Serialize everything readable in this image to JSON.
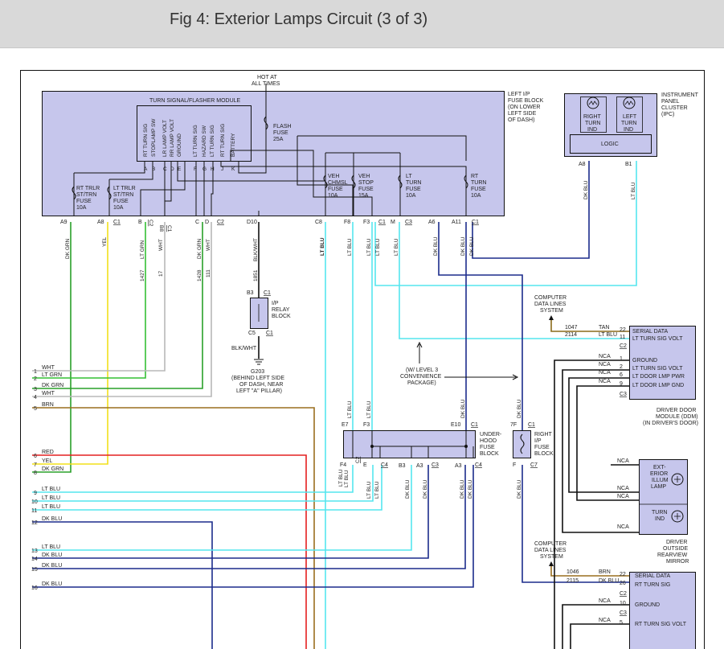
{
  "page": {
    "title": "Fig 4: Exterior Lamps Circuit (3 of 3)"
  },
  "colors": {
    "lt_blu": "#55e6ee",
    "dk_blu": "#1c2c8c",
    "dk_grn": "#2aa02a",
    "lt_grn": "#34c034",
    "yel": "#f2e01a",
    "wht": "#b8b8b8",
    "red": "#e42020",
    "brn": "#9a6e1e",
    "tan": "#8a6a1a",
    "module_fill": "#c6c6ec",
    "black": "#111111"
  },
  "hot": {
    "line1": "HOT AT",
    "line2": "ALL TIMES"
  },
  "ip_fuse_block": {
    "l1": "LEFT I/P",
    "l2": "FUSE BLOCK",
    "l3": "(ON LOWER",
    "l4": "LEFT SIDE",
    "l5": "OF DASH)"
  },
  "flasher": {
    "title": "TURN SIGNAL/FLASHER MODULE",
    "pins": [
      {
        "name": "RT TURN SIG",
        "letter": "A"
      },
      {
        "name": "STOPLAMP SW",
        "letter": "B"
      },
      {
        "name": "LR LAMP VOLT",
        "letter": "C"
      },
      {
        "name": "RR LAMP VOLT",
        "letter": "D"
      },
      {
        "name": "GROUND",
        "letter": "E"
      },
      {
        "name": "LT TURN SIG",
        "letter": "F"
      },
      {
        "name": "HAZARD SW",
        "letter": "G"
      },
      {
        "name": "LT TURN SIG",
        "letter": "H"
      },
      {
        "name": "RT TURN SIG",
        "letter": "J"
      },
      {
        "name": "BATTERY",
        "letter": "K"
      }
    ]
  },
  "fuses": {
    "flash": {
      "l1": "FLASH",
      "l2": "FUSE",
      "l3": "25A"
    },
    "rt_trlr": {
      "l1": "RT TRLR",
      "l2": "ST/TRN",
      "l3": "FUSE",
      "l4": "10A"
    },
    "lt_trlr": {
      "l1": "LT TRLR",
      "l2": "ST/TRN",
      "l3": "FUSE",
      "l4": "10A"
    },
    "veh_chmsl": {
      "l1": "VEH",
      "l2": "CHMSL",
      "l3": "FUSE",
      "l4": "10A"
    },
    "veh_stop": {
      "l1": "VEH",
      "l2": "STOP",
      "l3": "FUSE",
      "l4": "15A"
    },
    "lt_turn": {
      "l1": "LT",
      "l2": "TURN",
      "l3": "FUSE",
      "l4": "10A"
    },
    "rt_turn": {
      "l1": "RT",
      "l2": "TURN",
      "l3": "FUSE",
      "l4": "10A"
    }
  },
  "ipc": {
    "l1": "INSTRUMENT",
    "l2": "PANEL",
    "l3": "CLUSTER",
    "l4": "(IPC)",
    "right_turn": [
      "RIGHT",
      "TURN",
      "IND"
    ],
    "left_turn": [
      "LEFT",
      "TURN",
      "IND"
    ],
    "logic": "LOGIC",
    "pin_a8": "A8",
    "pin_b1": "B1",
    "wire_a8": "DK BLU",
    "wire_b1": "LT BLU"
  },
  "ip_connectors": {
    "a9": "A9",
    "a8": "A8",
    "c1a": "C1",
    "b": "B",
    "b8": "B8",
    "c1b": "C1",
    "c": "C",
    "d": "D",
    "c2": "C2",
    "d10": "D10",
    "c8": "C8",
    "f8": "F8",
    "f3": "F3",
    "c1c": "C1",
    "m": "M",
    "c3": "C3",
    "a6": "A6",
    "a11": "A11",
    "c1d": "C1"
  },
  "ip_wires": {
    "w1": "DK GRN",
    "w2": "YEL",
    "w3": "LT GRN",
    "n3": "1427",
    "w4": "WHT",
    "n4": "17",
    "w5": "DK GRN",
    "n5": "1428",
    "w6": "WHT",
    "n6": "111",
    "w7": "BLK/WHT",
    "n7": "1851",
    "w8": "LT BLU",
    "w9": "LT BLU",
    "w10": "LT BLU",
    "w11": "LT BLU",
    "w12": "DK BLU",
    "w13": "DK BLU",
    "w14": "LT BLU"
  },
  "relay_block": {
    "b3": "B3",
    "c1": "C1",
    "l1": "I/P",
    "l2": "RELAY",
    "l3": "BLOCK",
    "c5": "C5",
    "c1b": "C1",
    "wire": "BLK/WHT",
    "ground": "G203",
    "g1": "(BEHIND LEFT SIDE",
    "g2": "OF DASH, NEAR",
    "g3": "LEFT \"A\" PILLAR)"
  },
  "left_wires": [
    {
      "num": "1",
      "label": "WHT"
    },
    {
      "num": "2",
      "label": "LT GRN"
    },
    {
      "num": "3",
      "label": "DK GRN"
    },
    {
      "num": "4",
      "label": "WHT"
    },
    {
      "num": "5",
      "label": "BRN"
    },
    {
      "num": "6",
      "label": "RED"
    },
    {
      "num": "7",
      "label": "YEL"
    },
    {
      "num": "8",
      "label": "DK GRN"
    },
    {
      "num": "9",
      "label": "LT BLU"
    },
    {
      "num": "10",
      "label": "LT BLU"
    },
    {
      "num": "11",
      "label": "LT BLU"
    },
    {
      "num": "12",
      "label": "DK BLU"
    },
    {
      "num": "13",
      "label": "LT BLU"
    },
    {
      "num": "14",
      "label": "DK BLU"
    },
    {
      "num": "15",
      "label": "DK BLU"
    },
    {
      "num": "16",
      "label": "DK BLU"
    }
  ],
  "cdl1": {
    "l1": "COMPUTER",
    "l2": "DATA LINES",
    "l3": "SYSTEM"
  },
  "ddm": {
    "rows": [
      {
        "circuit": "1047",
        "wire": "TAN",
        "pin": "22",
        "fn": "SERIAL DATA"
      },
      {
        "circuit": "2114",
        "wire": "LT BLU",
        "pin": "11",
        "fn": "LT TURN SIG VOLT"
      },
      {
        "circuit": "",
        "wire": "",
        "pin": "C2",
        "fn": ""
      },
      {
        "circuit": "",
        "wire": "NCA",
        "pin": "1",
        "fn": "GROUND"
      },
      {
        "circuit": "",
        "wire": "NCA",
        "pin": "2",
        "fn": "LT TURN SIG VOLT"
      },
      {
        "circuit": "",
        "wire": "NCA",
        "pin": "6",
        "fn": "LT DOOR LMP PWR"
      },
      {
        "circuit": "",
        "wire": "NCA",
        "pin": "9",
        "fn": "LT DOOR LMP GND"
      },
      {
        "circuit": "",
        "wire": "",
        "pin": "C3",
        "fn": ""
      }
    ],
    "l1": "DRIVER DOOR",
    "l2": "MODULE (DDM)",
    "l3": "(IN DRIVER'S DOOR)"
  },
  "note": {
    "l1": "(W/ LEVEL 3",
    "l2": "CONVENIENCE",
    "l3": "PACKAGE)"
  },
  "underhood": {
    "l1": "UNDER-",
    "l2": "HOOD",
    "l3": "FUSE",
    "l4": "BLOCK",
    "e7": "E7",
    "f3": "F3",
    "e10": "E10",
    "c1": "C1",
    "f4": "F4",
    "c2": "C2",
    "e": "E",
    "c4": "C4",
    "b3": "B3",
    "a3a": "A3",
    "c3": "C3",
    "a3b": "A3",
    "c4b": "C4",
    "w_e7": "LT BLU",
    "w_f3": "LT BLU",
    "w_e10": "DK BLU",
    "w_f4": "LT BLU",
    "w_e": "LT BLU",
    "w_c4": "LT BLU",
    "w_b3": "DK BLU",
    "w_a3": "DK BLU",
    "w_a3b": "DK BLU"
  },
  "right_ip": {
    "l1": "RIGHT",
    "l2": "I/P",
    "l3": "FUSE",
    "l4": "BLOCK",
    "pin_top": "7F",
    "c1": "C1",
    "pin_bot": "F",
    "c7": "C7",
    "w_top": "DK BLU",
    "w_bot": "DK BLU"
  },
  "mirror": {
    "ext1": "EXT-",
    "ext2": "ERIOR",
    "ext3": "ILLUM",
    "ext4": "LAMP",
    "turn1": "TURN",
    "turn2": "IND",
    "nca1": "NCA",
    "nca2": "NCA",
    "nca3": "NCA",
    "nca4": "NCA",
    "l1": "DRIVER",
    "l2": "OUTSIDE",
    "l3": "REARVIEW",
    "l4": "MIRROR"
  },
  "cdl2": {
    "l1": "COMPUTER",
    "l2": "DATA LINES",
    "l3": "SYSTEM"
  },
  "pdm": {
    "rows": [
      {
        "circuit": "1046",
        "wire": "BRN",
        "pin": "22",
        "fn": "SERIAL DATA"
      },
      {
        "circuit": "2115",
        "wire": "DK BLU",
        "pin": "26",
        "fn": "RT TURN SIG"
      },
      {
        "circuit": "",
        "wire": "",
        "pin": "C2",
        "fn": ""
      },
      {
        "circuit": "",
        "wire": "NCA",
        "pin": "10",
        "fn": "GROUND"
      },
      {
        "circuit": "",
        "wire": "",
        "pin": "C3",
        "fn": ""
      },
      {
        "circuit": "",
        "wire": "NCA",
        "pin": "5",
        "fn": "RT TURN SIG VOLT"
      }
    ]
  }
}
